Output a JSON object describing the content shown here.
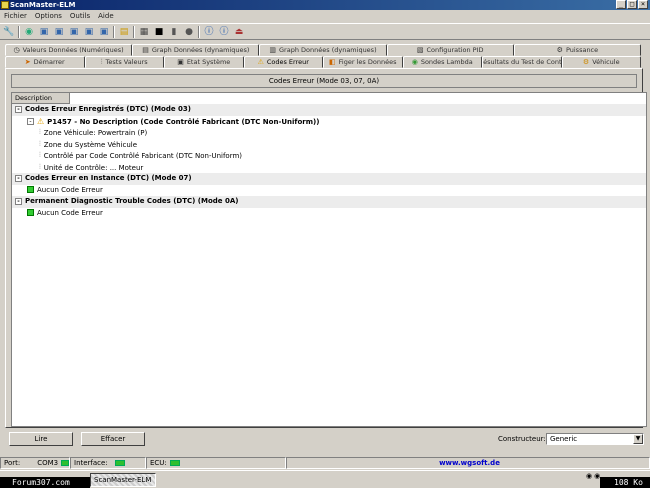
{
  "window": {
    "title": "ScanMaster-ELM"
  },
  "menu": [
    "Fichier",
    "Options",
    "Outils",
    "Aide"
  ],
  "toolbar_icons": [
    "wrench-icon",
    "connect-icon",
    "monitor-icon",
    "monitor-icon",
    "monitor-icon",
    "monitor-icon",
    "monitor-icon",
    "folder-icon",
    "chip-icon",
    "terminal-icon",
    "ecu-icon",
    "sensor-icon",
    "info-icon",
    "info-icon",
    "exit-icon"
  ],
  "tabs_row1": [
    {
      "label": "Valeurs Données (Numériques)",
      "icon": "gauge-icon"
    },
    {
      "label": "Graph Données (dynamiques)",
      "icon": "table-icon"
    },
    {
      "label": "Graph Données (dynamiques)",
      "icon": "graph-icon"
    },
    {
      "label": "Configuration PID",
      "icon": "config-icon"
    },
    {
      "label": "Puissance",
      "icon": "power-icon"
    }
  ],
  "tabs_row2": [
    {
      "label": "Démarrer",
      "icon": "start-icon"
    },
    {
      "label": "Tests Valeurs",
      "icon": "test-icon"
    },
    {
      "label": "Etat Système",
      "icon": "system-icon"
    },
    {
      "label": "Codes Erreur",
      "icon": "warning-icon",
      "active": true
    },
    {
      "label": "Figer les Données",
      "icon": "freeze-icon"
    },
    {
      "label": "Sondes Lambda",
      "icon": "lambda-icon"
    },
    {
      "label": "Résultats du Test de Contrôle",
      "icon": "result-icon"
    },
    {
      "label": "Véhicule",
      "icon": "car-icon"
    }
  ],
  "panel": {
    "heading": "Codes Erreur (Mode 03, 07, 0A)",
    "column_description": "Description",
    "rows": [
      {
        "level": 0,
        "type": "group",
        "expander": "-",
        "text": "Codes Erreur Enregistrés (DTC) (Mode 03)"
      },
      {
        "level": 1,
        "type": "warn",
        "expander": "-",
        "text": "P1457 - No Description (Code Contrôlé Fabricant (DTC Non-Uniform))"
      },
      {
        "level": 2,
        "type": "pin",
        "text": "Zone Véhicule: Powertrain (P)"
      },
      {
        "level": 2,
        "type": "pin",
        "text": "Zone du Système Véhicule"
      },
      {
        "level": 2,
        "type": "pin",
        "text": "Contrôlé par Code Contrôlé Fabricant (DTC Non-Uniform)"
      },
      {
        "level": 2,
        "type": "pin",
        "text": "Unité de Contrôle: ... Moteur"
      },
      {
        "level": 0,
        "type": "group",
        "expander": "-",
        "text": "Codes Erreur en Instance (DTC) (Mode 07)"
      },
      {
        "level": 1,
        "type": "ok",
        "text": "Aucun Code Erreur"
      },
      {
        "level": 0,
        "type": "group",
        "expander": "-",
        "text": "Permanent Diagnostic Trouble Codes (DTC) (Mode 0A)"
      },
      {
        "level": 1,
        "type": "ok",
        "text": "Aucun Code Erreur"
      }
    ]
  },
  "buttons": {
    "read": "Lire",
    "clear": "Effacer"
  },
  "builder": {
    "label": "Constructeur:",
    "value": "Generic"
  },
  "status": {
    "port_label": "Port:",
    "port_value": "COM3",
    "interface_label": "Interface:",
    "ecu_label": "ECU:",
    "url": "www.wgsoft.de"
  },
  "taskbar": {
    "task": "ScanMaster-ELM",
    "left_overlay": "Forum307.com",
    "right_overlay": "108 Ko"
  }
}
